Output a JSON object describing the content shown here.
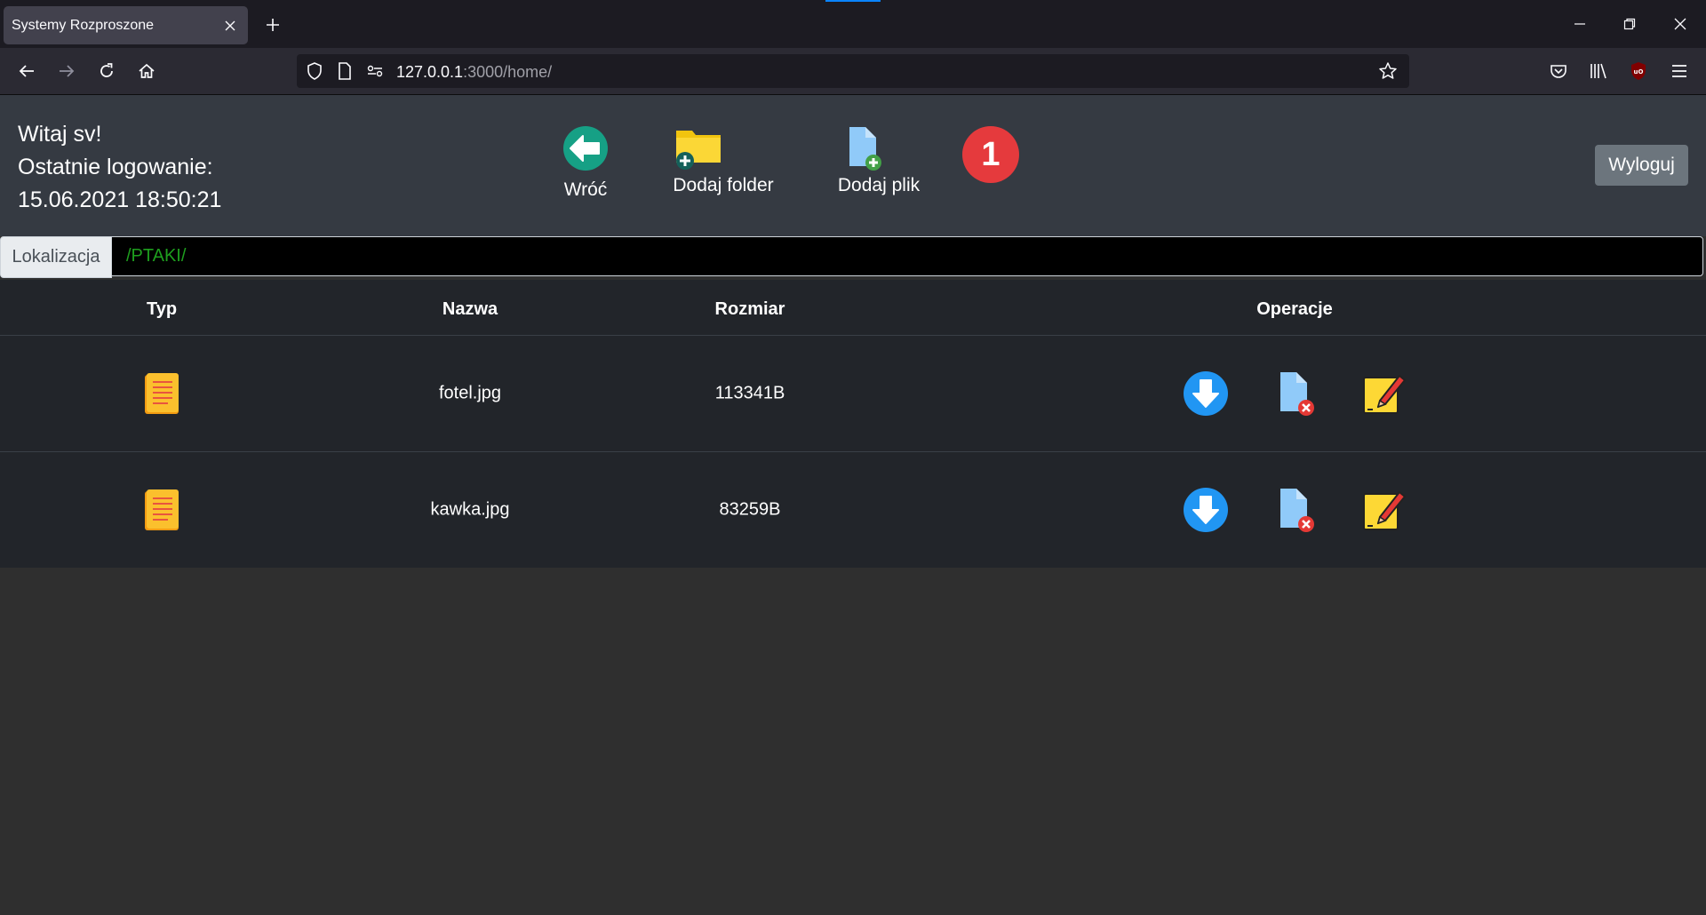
{
  "browser": {
    "tab_title": "Systemy Rozproszone",
    "url_host": "127.0.0.1",
    "url_path": ":3000/home/"
  },
  "header": {
    "greeting": "Witaj sv!",
    "last_login_label": "Ostatnie logowanie:",
    "last_login_value": "15.06.2021 18:50:21",
    "back_label": "Wróć",
    "add_folder_label": "Dodaj folder",
    "add_file_label": "Dodaj plik",
    "counter": "1",
    "logout_label": "Wyloguj"
  },
  "location": {
    "label": "Lokalizacja",
    "value": "/PTAKI/"
  },
  "table": {
    "columns": [
      "Typ",
      "Nazwa",
      "Rozmiar",
      "Operacje"
    ],
    "rows": [
      {
        "type_icon": "file-document-icon",
        "name": "fotel.jpg",
        "size": "113341B"
      },
      {
        "type_icon": "file-document-icon",
        "name": "kawka.jpg",
        "size": "83259B"
      }
    ]
  },
  "colors": {
    "header_bg": "#353a42",
    "table_bg": "#22252a",
    "page_bg": "#2f2f2f",
    "counter_red": "#e53a3d",
    "path_green": "#1e9e1e",
    "logout_gray": "#6c757d"
  }
}
